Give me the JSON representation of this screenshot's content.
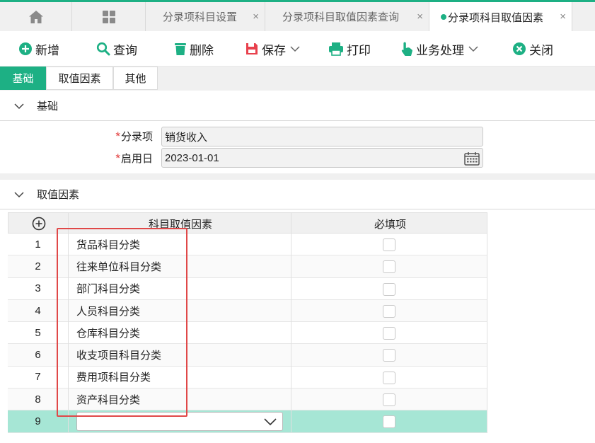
{
  "tabs": {
    "items": [
      {
        "label": "分录项科目设置",
        "close": "×"
      },
      {
        "label": "分录项科目取值因素查询",
        "close": "×"
      },
      {
        "label": "分录项科目取值因素",
        "close": "×"
      }
    ]
  },
  "toolbar": {
    "add": "新增",
    "query": "查询",
    "delete": "删除",
    "save": "保存",
    "print": "打印",
    "business": "业务处理",
    "close": "关闭"
  },
  "form_tabs": [
    "基础",
    "取值因素",
    "其他"
  ],
  "basic_section": {
    "title": "基础",
    "entry_label": "分录项",
    "entry_value": "销货收入",
    "start_label": "启用日",
    "start_value": "2023-01-01",
    "required_mark": "*"
  },
  "factor_section": {
    "title": "取值因素",
    "columns": [
      "科目取值因素",
      "必填项"
    ],
    "rows": [
      {
        "num": "1",
        "factor": "货品科目分类"
      },
      {
        "num": "2",
        "factor": "往来单位科目分类"
      },
      {
        "num": "3",
        "factor": "部门科目分类"
      },
      {
        "num": "4",
        "factor": "人员科目分类"
      },
      {
        "num": "5",
        "factor": "仓库科目分类"
      },
      {
        "num": "6",
        "factor": "收支项目科目分类"
      },
      {
        "num": "7",
        "factor": "费用项科目分类"
      },
      {
        "num": "8",
        "factor": "资产科目分类"
      }
    ],
    "new_row_num": "9"
  },
  "colors": {
    "accent": "#1db084",
    "required": "#e23b3b",
    "save_icon": "#e8414d",
    "highlight": "#e04848"
  }
}
